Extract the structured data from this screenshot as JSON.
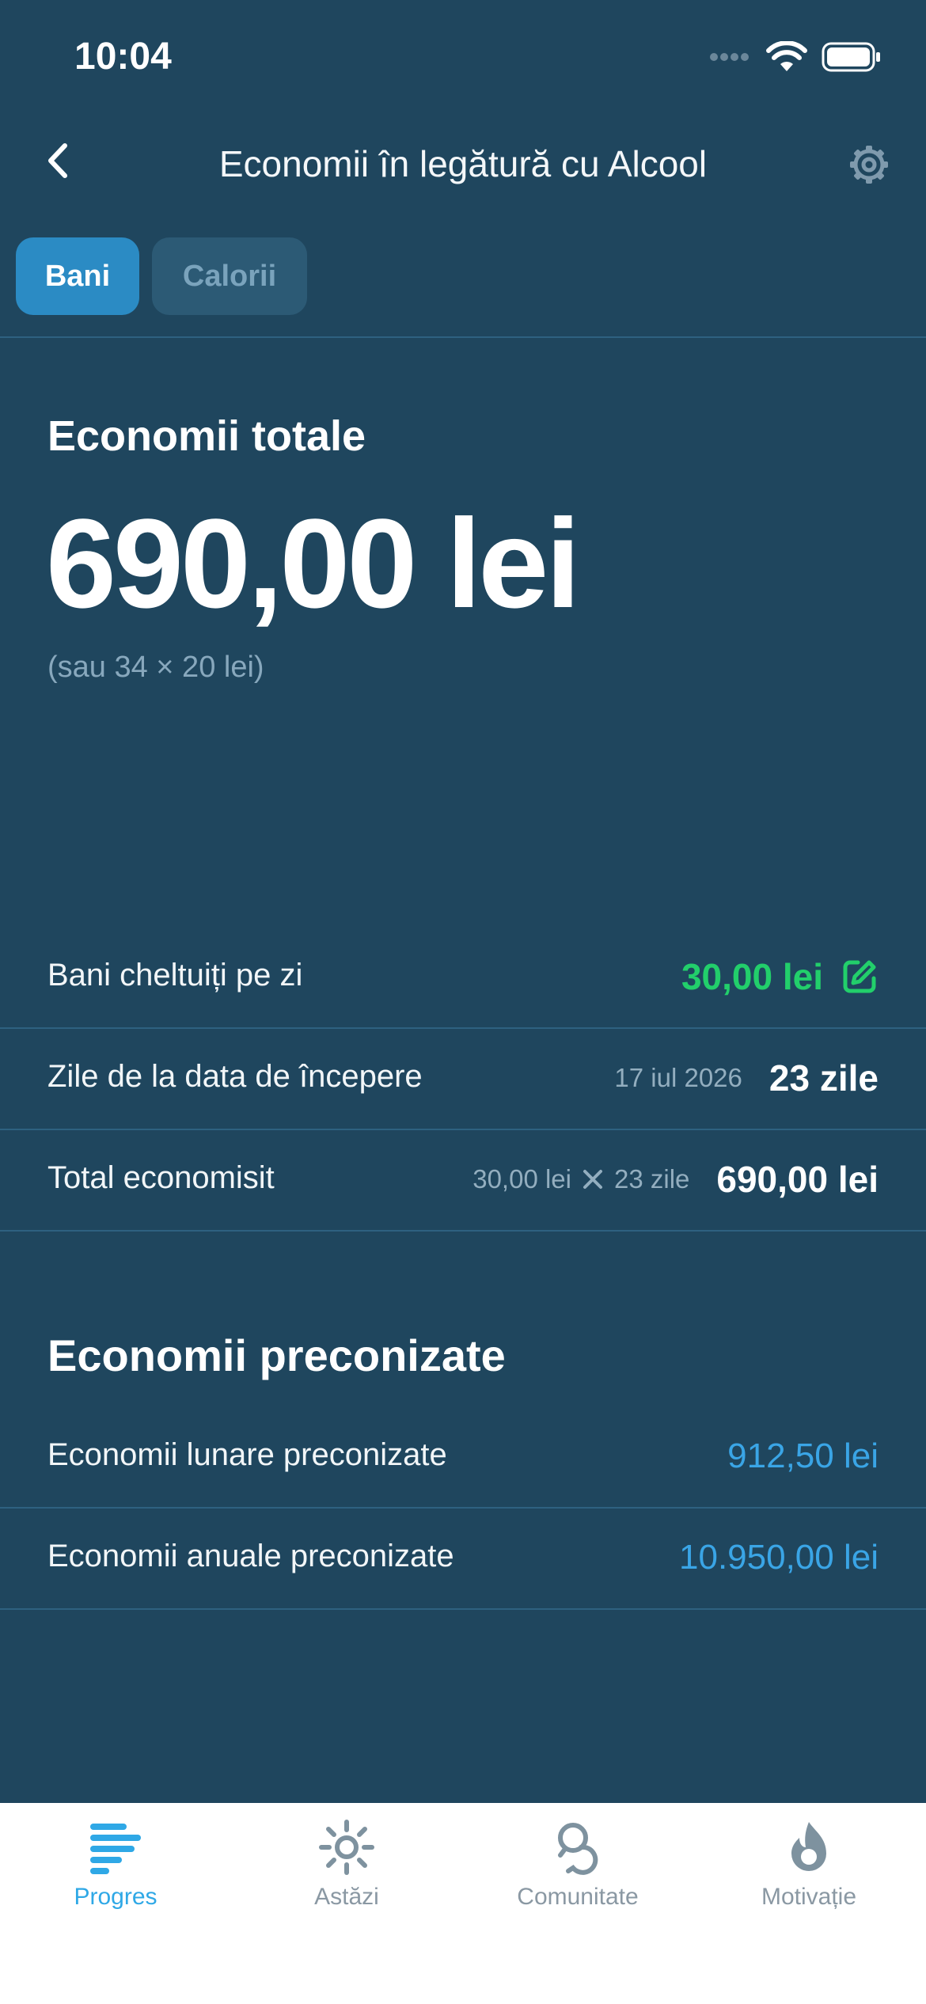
{
  "status_bar": {
    "time": "10:04"
  },
  "nav": {
    "title": "Economii în legătură cu Alcool"
  },
  "tabs": [
    {
      "label": "Bani"
    },
    {
      "label": "Calorii"
    }
  ],
  "total": {
    "title": "Economii totale",
    "amount": "690,00 lei",
    "subtitle": "(sau 34 × 20 lei)"
  },
  "details": {
    "daily": {
      "label": "Bani cheltuiți pe zi",
      "value": "30,00 lei"
    },
    "days": {
      "label": "Zile de la data de începere",
      "date": "17 iul 2026",
      "value": "23 zile"
    },
    "total": {
      "label": "Total economisit",
      "formula_a": "30,00 lei",
      "formula_b": "23 zile",
      "value": "690,00 lei"
    }
  },
  "projected": {
    "title": "Economii preconizate",
    "monthly": {
      "label": "Economii lunare preconizate",
      "value": "912,50 lei"
    },
    "yearly": {
      "label": "Economii anuale preconizate",
      "value": "10.950,00 lei"
    }
  },
  "tabbar": [
    {
      "label": "Progres",
      "icon": "progress-bars-icon",
      "active": true
    },
    {
      "label": "Astăzi",
      "icon": "sun-icon",
      "active": false
    },
    {
      "label": "Comunitate",
      "icon": "chat-bubbles-icon",
      "active": false
    },
    {
      "label": "Motivație",
      "icon": "flame-icon",
      "active": false
    }
  ],
  "colors": {
    "background": "#1f465e",
    "accent_blue": "#2b8bc4",
    "positive_green": "#22cf6b",
    "projection_blue": "#3aa5e6"
  }
}
